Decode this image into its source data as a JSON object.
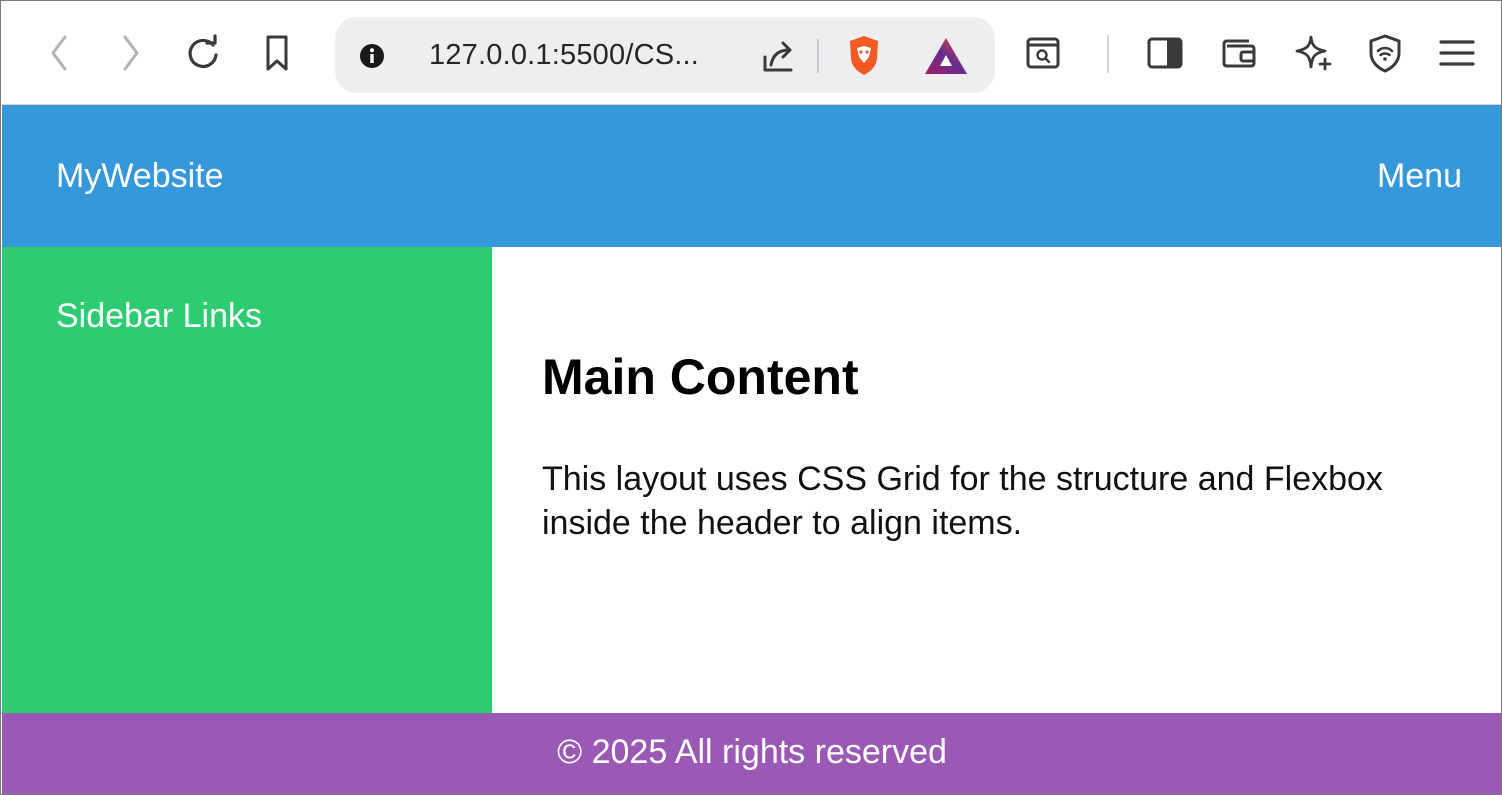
{
  "browser": {
    "url": "127.0.0.1:5500/CS...",
    "icons": [
      "back-icon",
      "forward-icon",
      "reload-icon",
      "bookmark-icon",
      "site-info-icon",
      "share-icon",
      "brave-shields-icon",
      "brave-rewards-icon",
      "search-tab-icon",
      "sidebar-icon",
      "wallet-icon",
      "leo-ai-icon",
      "vpn-icon",
      "menu-icon"
    ]
  },
  "header": {
    "brand": "MyWebsite",
    "menu": "Menu"
  },
  "sidebar": {
    "title": "Sidebar Links"
  },
  "main": {
    "heading": "Main Content",
    "paragraph": "This layout uses CSS Grid for the structure and Flexbox inside the header to align items."
  },
  "footer": {
    "text": "© 2025 All rights reserved"
  },
  "colors": {
    "header": "#3498db",
    "sidebar": "#2ecc71",
    "footer": "#9b59b6"
  }
}
